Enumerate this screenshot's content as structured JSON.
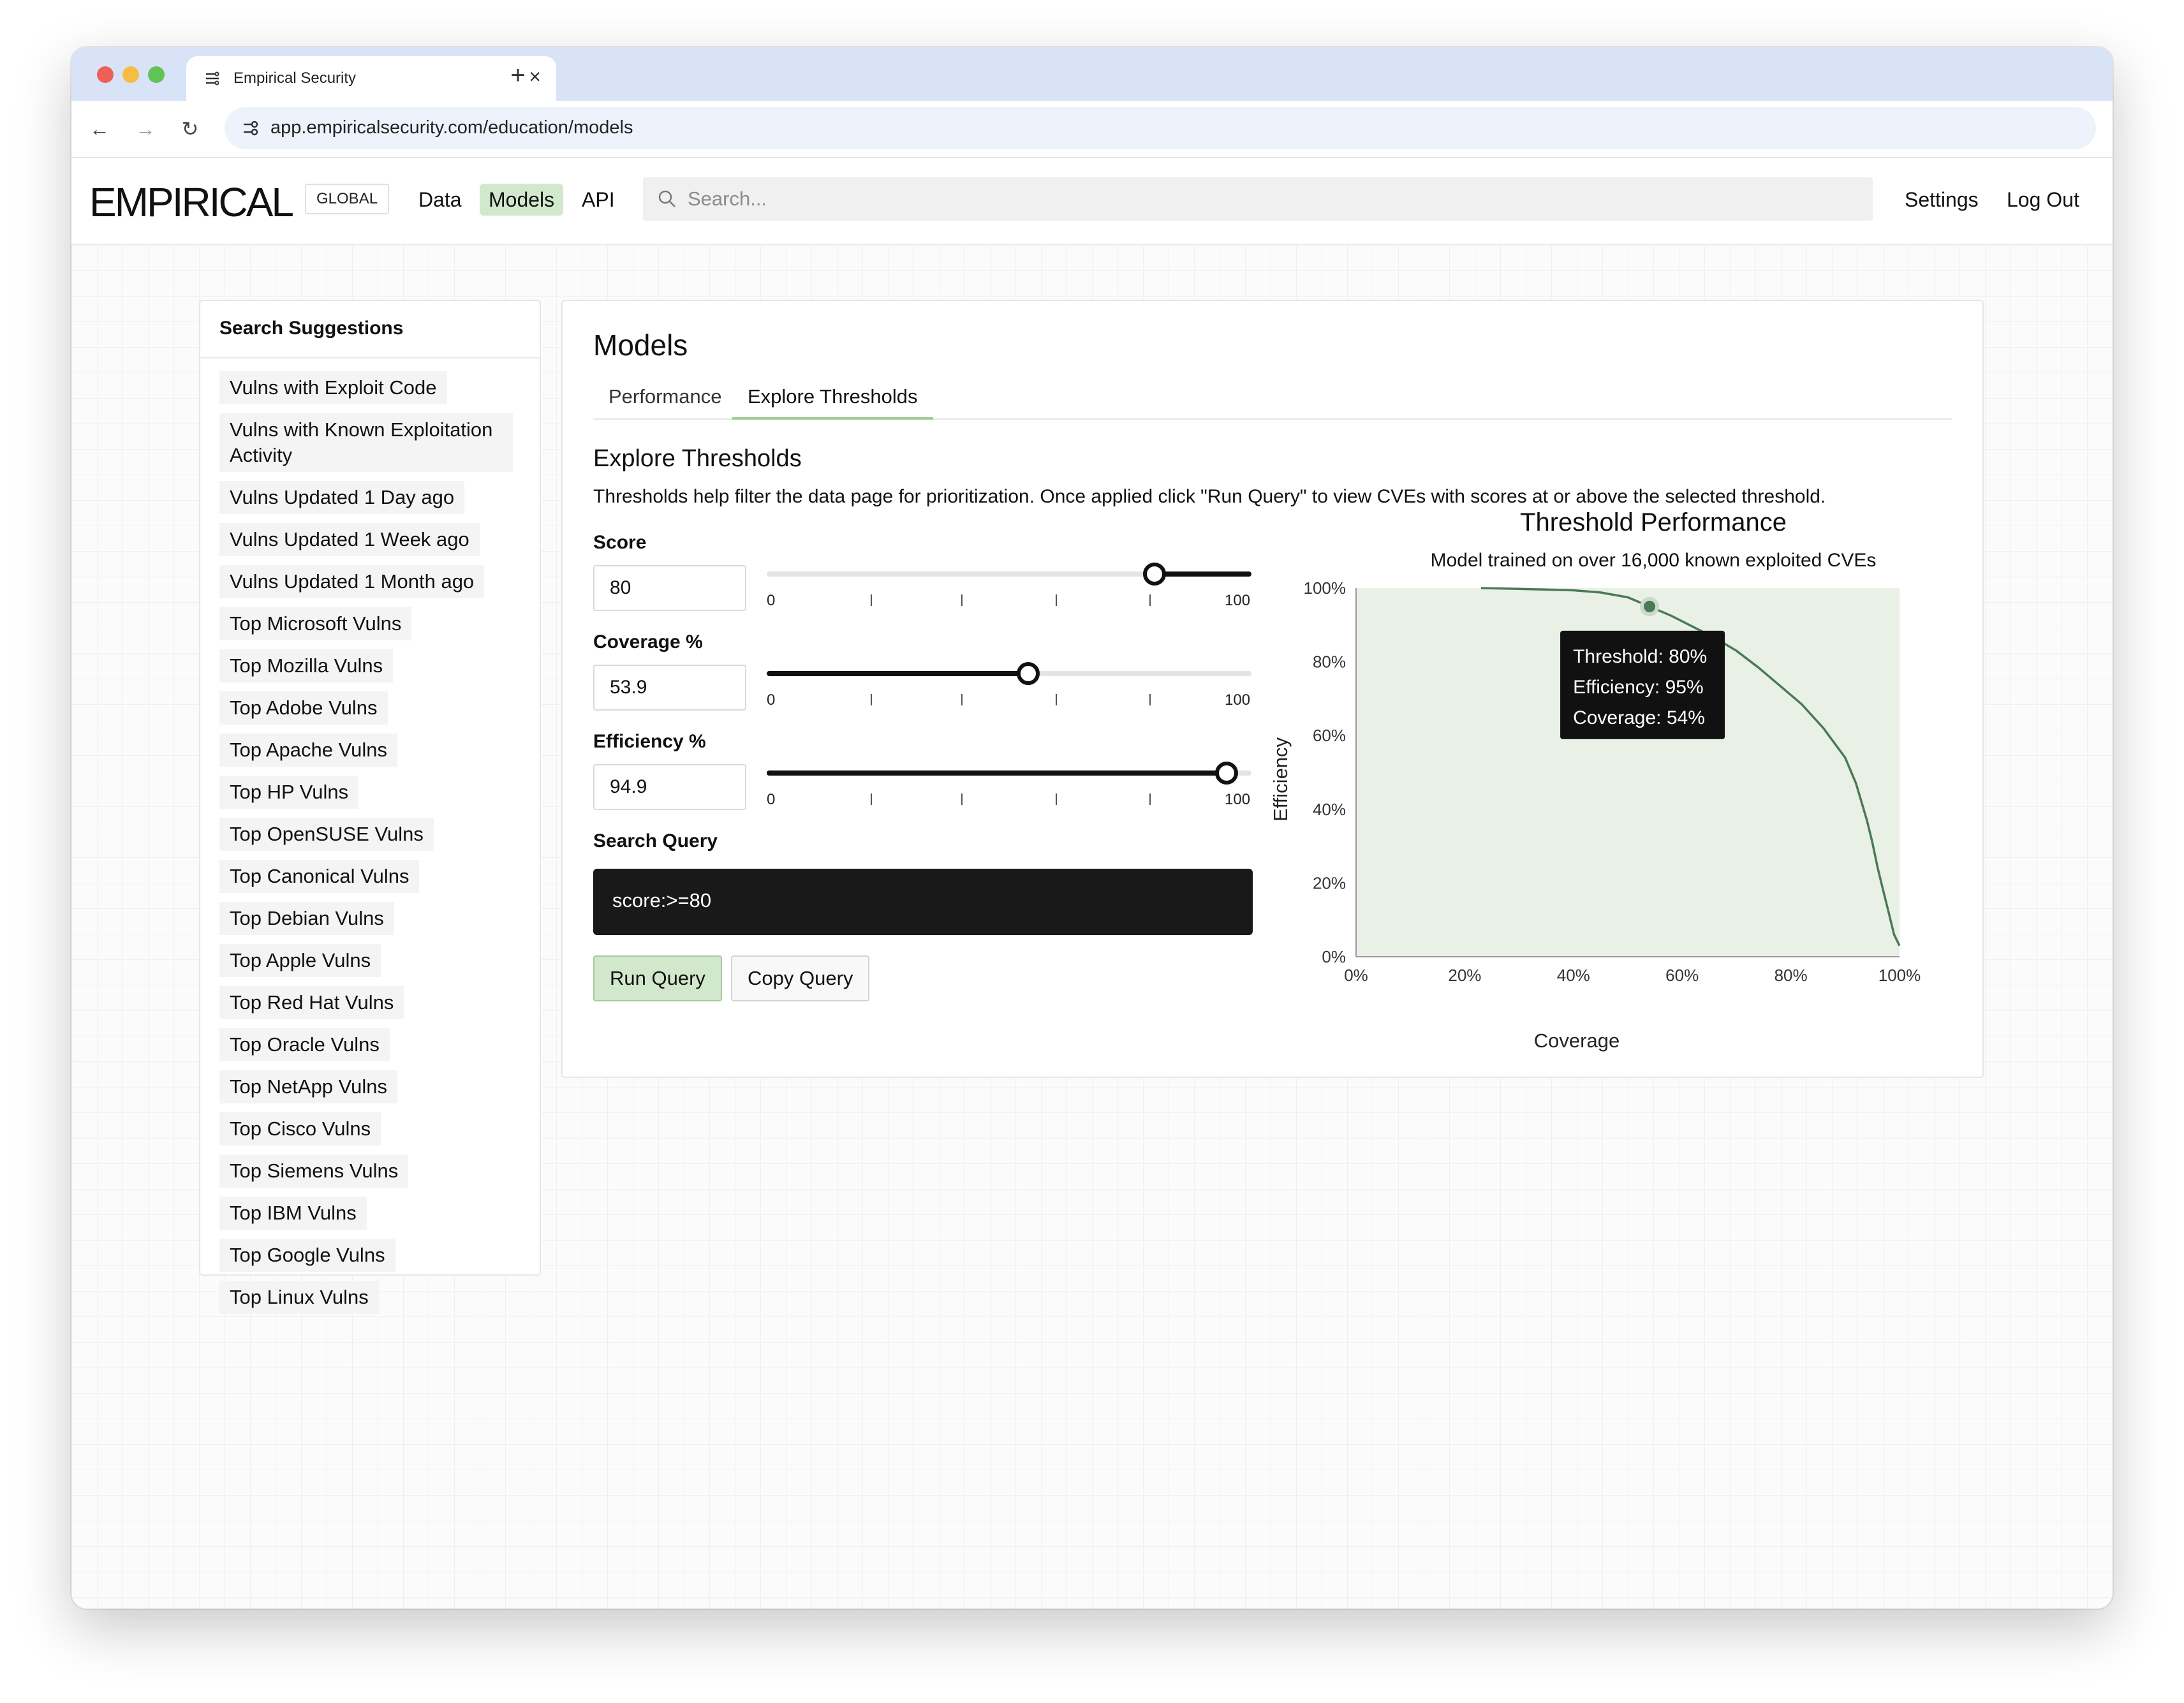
{
  "browser": {
    "tab_title": "Empirical Security",
    "url": "app.empiricalsecurity.com/education/models"
  },
  "header": {
    "logo": "EMPIRICAL",
    "badge": "GLOBAL",
    "nav": {
      "data": "Data",
      "models": "Models",
      "api": "API"
    },
    "search_placeholder": "Search...",
    "settings": "Settings",
    "logout": "Log Out"
  },
  "sidebar": {
    "title": "Search Suggestions",
    "items": [
      "Vulns with Exploit Code",
      "Vulns with Known Exploitation Activity",
      "Vulns Updated 1 Day ago",
      "Vulns Updated 1 Week ago",
      "Vulns Updated 1 Month ago",
      "Top Microsoft Vulns",
      "Top Mozilla Vulns",
      "Top Adobe Vulns",
      "Top Apache Vulns",
      "Top HP Vulns",
      "Top OpenSUSE Vulns",
      "Top Canonical Vulns",
      "Top Debian Vulns",
      "Top Apple Vulns",
      "Top Red Hat Vulns",
      "Top Oracle Vulns",
      "Top NetApp Vulns",
      "Top Cisco Vulns",
      "Top Siemens Vulns",
      "Top IBM Vulns",
      "Top Google Vulns",
      "Top Linux Vulns"
    ]
  },
  "main": {
    "title": "Models",
    "tabs": {
      "performance": "Performance",
      "thresholds": "Explore Thresholds"
    },
    "section_title": "Explore Thresholds",
    "description": "Thresholds help filter the data page for prioritization. Once applied click \"Run Query\" to view CVEs with scores at or above the selected threshold.",
    "fields": {
      "score": {
        "label": "Score",
        "value": "80",
        "slider_value": 80
      },
      "coverage": {
        "label": "Coverage %",
        "value": "53.9",
        "slider_value": 53.9
      },
      "efficiency": {
        "label": "Efficiency %",
        "value": "94.9",
        "slider_value": 94.9
      }
    },
    "slider_min_label": "0",
    "slider_max_label": "100",
    "query_label": "Search Query",
    "query": "score:>=80",
    "run_button": "Run Query",
    "copy_button": "Copy Query"
  },
  "chart_data": {
    "type": "line",
    "title": "Threshold Performance",
    "subtitle": "Model trained on over 16,000 known exploited CVEs",
    "xlabel": "Coverage",
    "ylabel": "Efficiency",
    "xlim": [
      0,
      100
    ],
    "ylim": [
      0,
      100
    ],
    "x_ticks": [
      "0%",
      "20%",
      "40%",
      "60%",
      "80%",
      "100%"
    ],
    "y_ticks": [
      "0%",
      "20%",
      "40%",
      "60%",
      "80%",
      "100%"
    ],
    "grid": false,
    "series": [
      {
        "x": [
          23,
          30,
          40,
          45,
          50,
          54,
          58,
          62,
          66,
          70,
          74,
          78,
          82,
          86,
          88,
          90,
          92,
          94,
          95,
          96,
          97,
          98,
          99,
          100
        ],
        "y": [
          100,
          99.8,
          99.4,
          98.8,
          97.5,
          95,
          92.5,
          89.5,
          86.5,
          83,
          78.5,
          73.5,
          68.5,
          62,
          58,
          54,
          47,
          37,
          31,
          24,
          18,
          12,
          6,
          3
        ]
      }
    ],
    "highlight": {
      "x": 54,
      "y": 95
    },
    "tooltip": {
      "threshold": "Threshold: 80%",
      "efficiency": "Efficiency: 95%",
      "coverage": "Coverage: 54%"
    },
    "colors": {
      "line": "#4a7a55",
      "plot_bg": "#e9f0e6",
      "tooltip_bg": "#111111"
    }
  }
}
